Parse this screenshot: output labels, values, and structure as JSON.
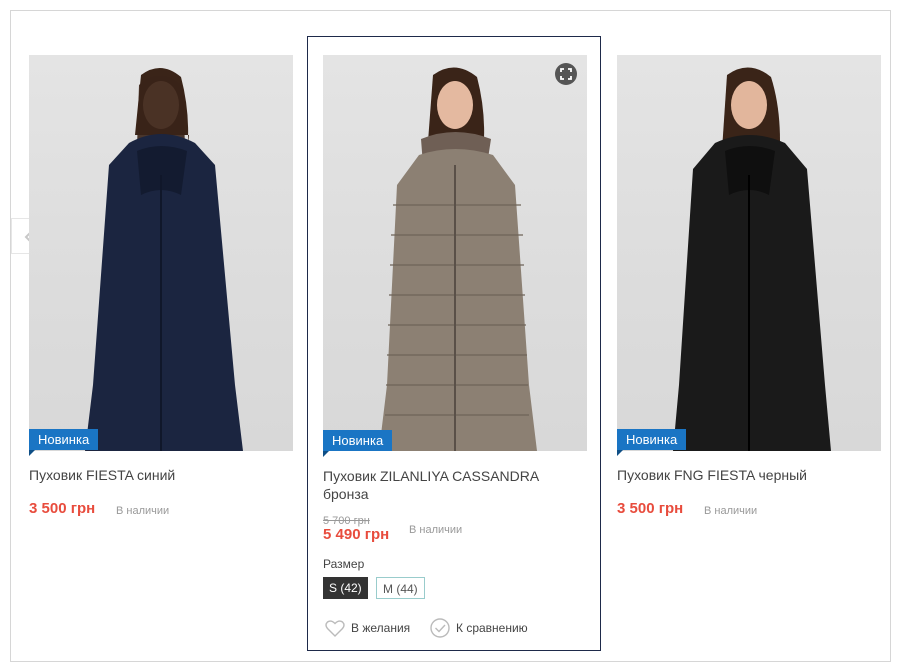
{
  "products": [
    {
      "badge": "Новинка",
      "name": "Пуховик FIESTA синий",
      "price": "3 500 грн",
      "stock": "В наличии",
      "coat_color": "#1b2540"
    },
    {
      "badge": "Новинка",
      "name": "Пуховик ZILANLIYA CASSANDRA бронза",
      "old_price": "5 700 грн",
      "price": "5 490 грн",
      "stock": "В наличии",
      "size_label": "Размер",
      "sizes": [
        {
          "label": "S (42)",
          "selected": true
        },
        {
          "label": "M (44)",
          "selected": false
        }
      ],
      "wishlist": "В желания",
      "compare": "К сравнению",
      "coat_color": "#8c8073"
    },
    {
      "badge": "Новинка",
      "name": "Пуховик FNG FIESTA черный",
      "price": "3 500 грн",
      "stock": "В наличии",
      "coat_color": "#1a1a1a"
    }
  ],
  "colors": {
    "badge": "#1a75c4",
    "price": "#e84c3d",
    "active_border": "#1e2a4a"
  },
  "icons": [
    "chevron-left-icon",
    "zoom-icon",
    "heart-icon",
    "check-circle-icon"
  ]
}
